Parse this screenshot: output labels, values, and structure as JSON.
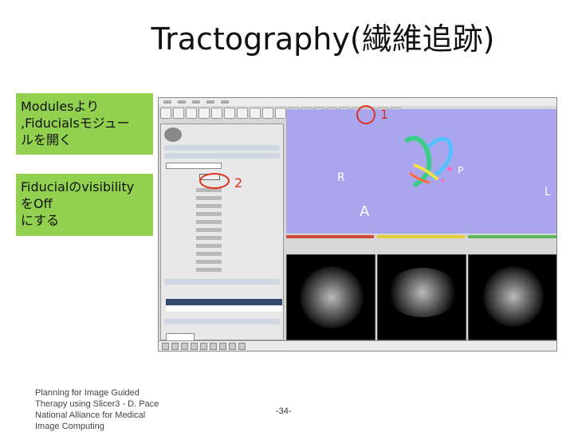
{
  "slide": {
    "title": "Tractography(繊維追跡)",
    "note1": "Modulesより\n,Fiducialsモジュー\nルを開く",
    "note2": "Fiducialのvisibility\nをOff\nにする",
    "footer": "Planning for Image Guided Therapy using Slicer3 - D. Pace National Alliance for Medical Image Computing",
    "page_number": "-34-"
  },
  "screenshot": {
    "callout1": "1",
    "callout2": "2",
    "axis_labels": {
      "right": "R",
      "posterior": "P",
      "anterior": "A",
      "left": "L"
    },
    "colors": {
      "view3d_bg": "#a9a6ee",
      "callout": "#e0301e",
      "note_bg": "#92d050"
    }
  }
}
